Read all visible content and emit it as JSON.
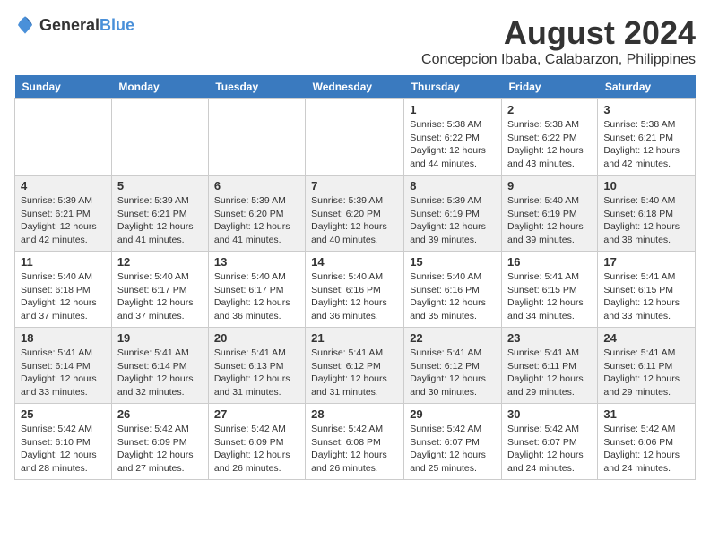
{
  "logo": {
    "text_general": "General",
    "text_blue": "Blue"
  },
  "title": "August 2024",
  "subtitle": "Concepcion Ibaba, Calabarzon, Philippines",
  "days_of_week": [
    "Sunday",
    "Monday",
    "Tuesday",
    "Wednesday",
    "Thursday",
    "Friday",
    "Saturday"
  ],
  "weeks": [
    {
      "days": [
        {
          "num": "",
          "content": ""
        },
        {
          "num": "",
          "content": ""
        },
        {
          "num": "",
          "content": ""
        },
        {
          "num": "",
          "content": ""
        },
        {
          "num": "1",
          "content": "Sunrise: 5:38 AM\nSunset: 6:22 PM\nDaylight: 12 hours and 44 minutes."
        },
        {
          "num": "2",
          "content": "Sunrise: 5:38 AM\nSunset: 6:22 PM\nDaylight: 12 hours and 43 minutes."
        },
        {
          "num": "3",
          "content": "Sunrise: 5:38 AM\nSunset: 6:21 PM\nDaylight: 12 hours and 42 minutes."
        }
      ]
    },
    {
      "days": [
        {
          "num": "4",
          "content": "Sunrise: 5:39 AM\nSunset: 6:21 PM\nDaylight: 12 hours and 42 minutes."
        },
        {
          "num": "5",
          "content": "Sunrise: 5:39 AM\nSunset: 6:21 PM\nDaylight: 12 hours and 41 minutes."
        },
        {
          "num": "6",
          "content": "Sunrise: 5:39 AM\nSunset: 6:20 PM\nDaylight: 12 hours and 41 minutes."
        },
        {
          "num": "7",
          "content": "Sunrise: 5:39 AM\nSunset: 6:20 PM\nDaylight: 12 hours and 40 minutes."
        },
        {
          "num": "8",
          "content": "Sunrise: 5:39 AM\nSunset: 6:19 PM\nDaylight: 12 hours and 39 minutes."
        },
        {
          "num": "9",
          "content": "Sunrise: 5:40 AM\nSunset: 6:19 PM\nDaylight: 12 hours and 39 minutes."
        },
        {
          "num": "10",
          "content": "Sunrise: 5:40 AM\nSunset: 6:18 PM\nDaylight: 12 hours and 38 minutes."
        }
      ]
    },
    {
      "days": [
        {
          "num": "11",
          "content": "Sunrise: 5:40 AM\nSunset: 6:18 PM\nDaylight: 12 hours and 37 minutes."
        },
        {
          "num": "12",
          "content": "Sunrise: 5:40 AM\nSunset: 6:17 PM\nDaylight: 12 hours and 37 minutes."
        },
        {
          "num": "13",
          "content": "Sunrise: 5:40 AM\nSunset: 6:17 PM\nDaylight: 12 hours and 36 minutes."
        },
        {
          "num": "14",
          "content": "Sunrise: 5:40 AM\nSunset: 6:16 PM\nDaylight: 12 hours and 36 minutes."
        },
        {
          "num": "15",
          "content": "Sunrise: 5:40 AM\nSunset: 6:16 PM\nDaylight: 12 hours and 35 minutes."
        },
        {
          "num": "16",
          "content": "Sunrise: 5:41 AM\nSunset: 6:15 PM\nDaylight: 12 hours and 34 minutes."
        },
        {
          "num": "17",
          "content": "Sunrise: 5:41 AM\nSunset: 6:15 PM\nDaylight: 12 hours and 33 minutes."
        }
      ]
    },
    {
      "days": [
        {
          "num": "18",
          "content": "Sunrise: 5:41 AM\nSunset: 6:14 PM\nDaylight: 12 hours and 33 minutes."
        },
        {
          "num": "19",
          "content": "Sunrise: 5:41 AM\nSunset: 6:14 PM\nDaylight: 12 hours and 32 minutes."
        },
        {
          "num": "20",
          "content": "Sunrise: 5:41 AM\nSunset: 6:13 PM\nDaylight: 12 hours and 31 minutes."
        },
        {
          "num": "21",
          "content": "Sunrise: 5:41 AM\nSunset: 6:12 PM\nDaylight: 12 hours and 31 minutes."
        },
        {
          "num": "22",
          "content": "Sunrise: 5:41 AM\nSunset: 6:12 PM\nDaylight: 12 hours and 30 minutes."
        },
        {
          "num": "23",
          "content": "Sunrise: 5:41 AM\nSunset: 6:11 PM\nDaylight: 12 hours and 29 minutes."
        },
        {
          "num": "24",
          "content": "Sunrise: 5:41 AM\nSunset: 6:11 PM\nDaylight: 12 hours and 29 minutes."
        }
      ]
    },
    {
      "days": [
        {
          "num": "25",
          "content": "Sunrise: 5:42 AM\nSunset: 6:10 PM\nDaylight: 12 hours and 28 minutes."
        },
        {
          "num": "26",
          "content": "Sunrise: 5:42 AM\nSunset: 6:09 PM\nDaylight: 12 hours and 27 minutes."
        },
        {
          "num": "27",
          "content": "Sunrise: 5:42 AM\nSunset: 6:09 PM\nDaylight: 12 hours and 26 minutes."
        },
        {
          "num": "28",
          "content": "Sunrise: 5:42 AM\nSunset: 6:08 PM\nDaylight: 12 hours and 26 minutes."
        },
        {
          "num": "29",
          "content": "Sunrise: 5:42 AM\nSunset: 6:07 PM\nDaylight: 12 hours and 25 minutes."
        },
        {
          "num": "30",
          "content": "Sunrise: 5:42 AM\nSunset: 6:07 PM\nDaylight: 12 hours and 24 minutes."
        },
        {
          "num": "31",
          "content": "Sunrise: 5:42 AM\nSunset: 6:06 PM\nDaylight: 12 hours and 24 minutes."
        }
      ]
    }
  ]
}
